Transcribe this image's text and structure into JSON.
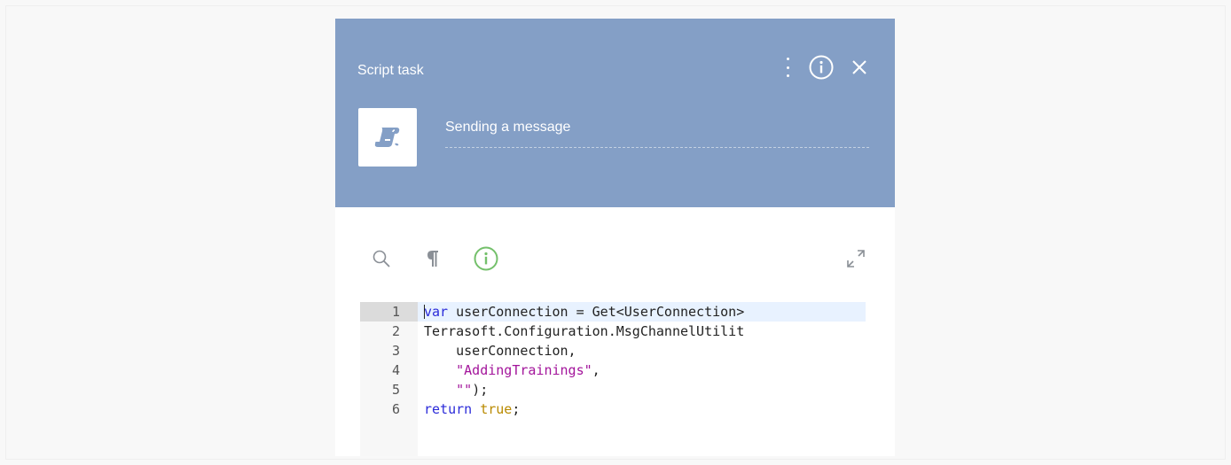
{
  "panel": {
    "title": "Script task",
    "element_name": "Sending a message",
    "header_bg": "#849fc6"
  },
  "header_icons": {
    "menu": "kebab-menu-icon",
    "info": "info-circle-icon",
    "close": "close-icon"
  },
  "toolbar": {
    "search": "search-icon",
    "show_whitespace": "pilcrow-icon",
    "info": "info-circle-icon",
    "fullscreen": "expand-icon",
    "info_accent": "#74c06b"
  },
  "code": {
    "lines": [
      {
        "number": "1",
        "tokens": [
          {
            "t": "var",
            "k": "keyword"
          },
          {
            "t": " userConnection = Get<UserConnection>",
            "k": "plain"
          }
        ]
      },
      {
        "number": "2",
        "tokens": [
          {
            "t": "Terrasoft.Configuration.MsgChannelUtilit",
            "k": "plain"
          }
        ]
      },
      {
        "number": "3",
        "tokens": [
          {
            "t": "    userConnection,",
            "k": "plain"
          }
        ]
      },
      {
        "number": "4",
        "tokens": [
          {
            "t": "    ",
            "k": "plain"
          },
          {
            "t": "\"AddingTrainings\"",
            "k": "string"
          },
          {
            "t": ",",
            "k": "plain"
          }
        ]
      },
      {
        "number": "5",
        "tokens": [
          {
            "t": "    ",
            "k": "plain"
          },
          {
            "t": "\"\"",
            "k": "string"
          },
          {
            "t": ");",
            "k": "plain"
          }
        ]
      },
      {
        "number": "6",
        "tokens": [
          {
            "t": "return",
            "k": "keyword"
          },
          {
            "t": " ",
            "k": "plain"
          },
          {
            "t": "true",
            "k": "bool"
          },
          {
            "t": ";",
            "k": "plain"
          }
        ]
      }
    ],
    "active_line": "1"
  }
}
